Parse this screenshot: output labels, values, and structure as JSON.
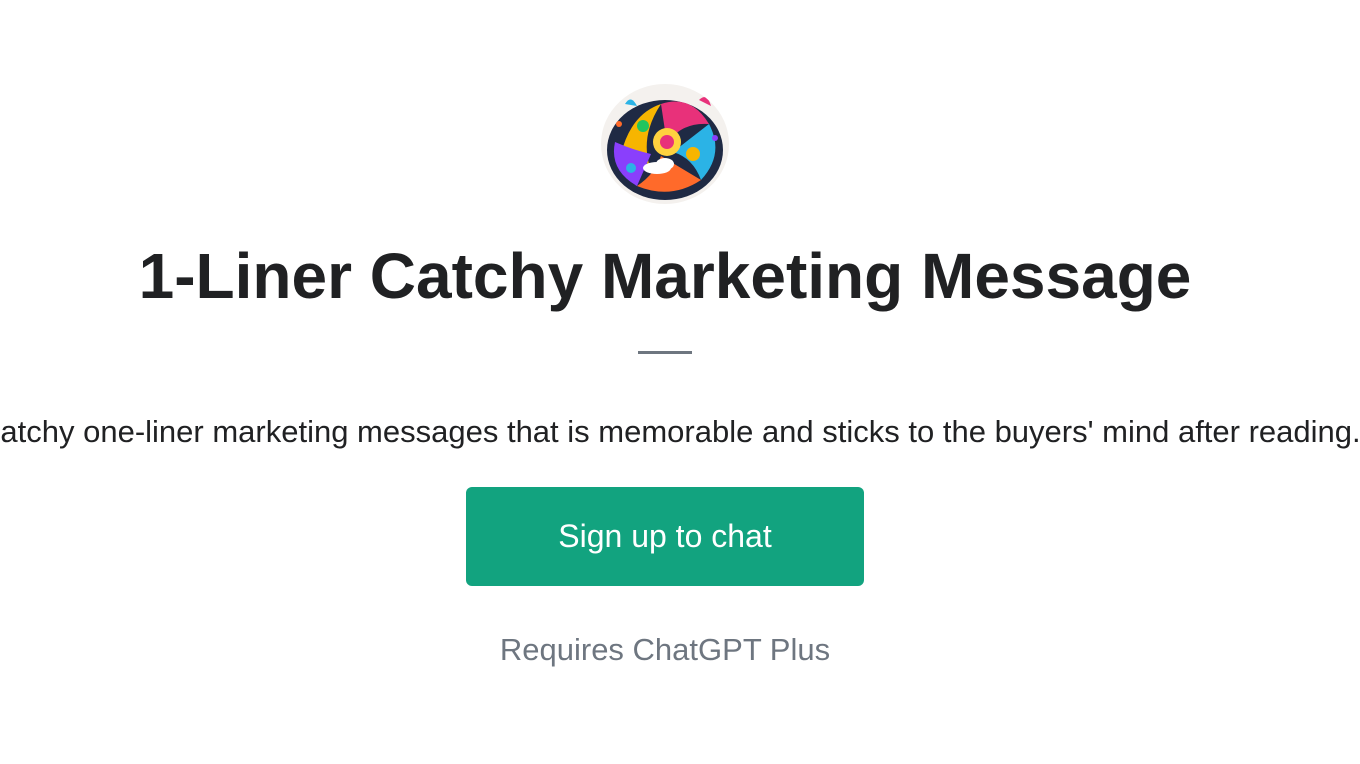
{
  "gpt": {
    "avatar_icon": "colorful-abstract-splash-avatar",
    "title": "1-Liner Catchy Marketing Message",
    "description": "Catchy one-liner marketing messages that is memorable and sticks to the buyers' mind after reading."
  },
  "actions": {
    "signup_label": "Sign up to chat"
  },
  "footer": {
    "requirement": "Requires ChatGPT Plus"
  },
  "colors": {
    "accent": "#12a37f",
    "title_text": "#202123",
    "muted_text": "#6e7680",
    "background": "#ffffff"
  }
}
